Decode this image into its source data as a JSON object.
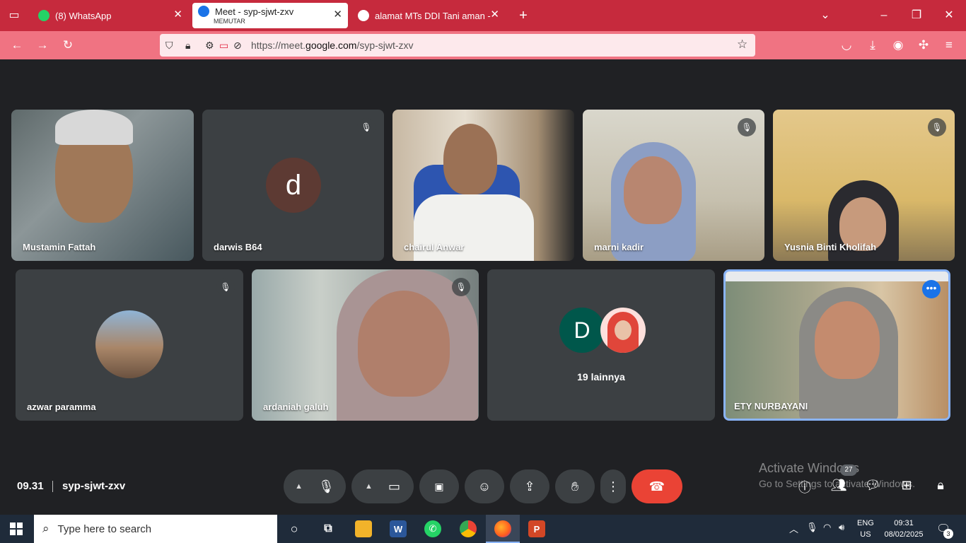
{
  "browser": {
    "tabs": [
      {
        "title": "(8) WhatsApp",
        "icon": "whatsapp-icon",
        "color": "#25d366"
      },
      {
        "title": "Meet - syp-sjwt-zxv",
        "subtitle": "MEMUTAR",
        "icon": "google-meet-icon",
        "active": true
      },
      {
        "title": "alamat MTs DDI Tani aman - Per",
        "icon": "google-icon"
      }
    ],
    "url_prefix": "https://meet.",
    "url_domain": "google.com",
    "url_path": "/syp-sjwt-zxv",
    "theme_color": "#c62a3d"
  },
  "meet": {
    "participants_row1": [
      {
        "name": "Mustamin Fattah",
        "muted": false
      },
      {
        "name": "darwis B64",
        "muted": true,
        "avatar_letter": "d",
        "avatar_color": "#5d3a33"
      },
      {
        "name": "chairul Anwar",
        "muted": false
      },
      {
        "name": "marni kadir",
        "muted": true
      },
      {
        "name": "Yusnia Binti Kholifah",
        "muted": true
      }
    ],
    "participants_row2": [
      {
        "name": "azwar paramma",
        "muted": true
      },
      {
        "name": "ardaniah galuh",
        "muted": true
      },
      {
        "name": "19 lainnya",
        "avatar_letter": "D",
        "avatar_color": "#00574b"
      },
      {
        "name": "ETY NURBAYANI",
        "active_speaker": true
      }
    ],
    "time": "09.31",
    "meeting_code": "syp-sjwt-zxv",
    "participant_count": "27",
    "leave_color": "#ea4335"
  },
  "watermark": {
    "line1": "Activate Windows",
    "line2": "Go to Settings to activate Windows."
  },
  "taskbar": {
    "search_placeholder": "Type here to search",
    "lang_line1": "ENG",
    "lang_line2": "US",
    "time": "09:31",
    "date": "08/02/2025",
    "notifications": "3"
  }
}
